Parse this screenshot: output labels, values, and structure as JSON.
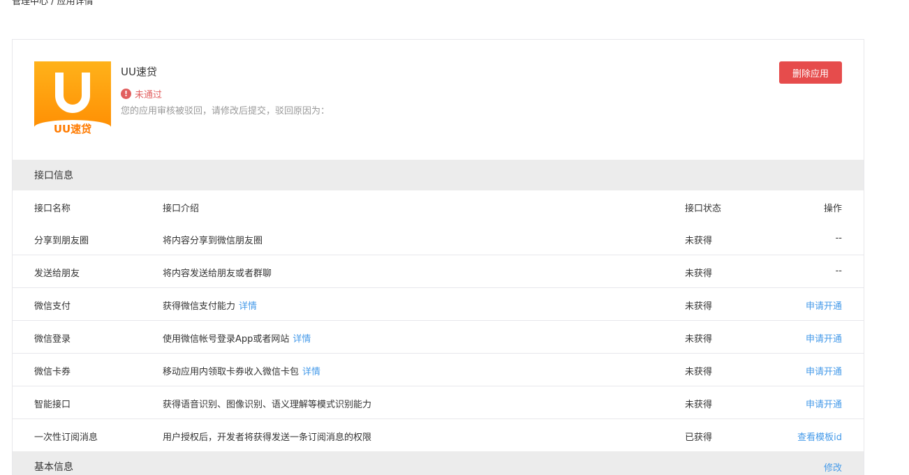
{
  "breadcrumb": "管理中心 / 应用详情",
  "app": {
    "name": "UU速贷",
    "icon_label": "UU速贷",
    "status": "未通过",
    "reason": "您的应用审核被驳回，请修改后提交，驳回原因为：",
    "delete_label": "删除应用"
  },
  "interfaces": {
    "section_title": "接口信息",
    "columns": {
      "name": "接口名称",
      "desc": "接口介绍",
      "state": "接口状态",
      "op": "操作"
    },
    "rows": [
      {
        "name": "分享到朋友圈",
        "desc": "将内容分享到微信朋友圈",
        "detail": "",
        "state": "未获得",
        "op": "--",
        "op_link": false
      },
      {
        "name": "发送给朋友",
        "desc": "将内容发送给朋友或者群聊",
        "detail": "",
        "state": "未获得",
        "op": "--",
        "op_link": false
      },
      {
        "name": "微信支付",
        "desc": "获得微信支付能力",
        "detail": "详情",
        "state": "未获得",
        "op": "申请开通",
        "op_link": true
      },
      {
        "name": "微信登录",
        "desc": "使用微信帐号登录App或者网站",
        "detail": "详情",
        "state": "未获得",
        "op": "申请开通",
        "op_link": true
      },
      {
        "name": "微信卡券",
        "desc": "移动应用内领取卡券收入微信卡包",
        "detail": "详情",
        "state": "未获得",
        "op": "申请开通",
        "op_link": true
      },
      {
        "name": "智能接口",
        "desc": "获得语音识别、图像识别、语义理解等模式识别能力",
        "detail": "",
        "state": "未获得",
        "op": "申请开通",
        "op_link": true
      },
      {
        "name": "一次性订阅消息",
        "desc": "用户授权后，开发者将获得发送一条订阅消息的权限",
        "detail": "",
        "state": "已获得",
        "op": "查看模板id",
        "op_link": true
      }
    ]
  },
  "basic": {
    "section_title": "基本信息",
    "edit_label": "修改"
  },
  "colors": {
    "accent_link": "#459ae9",
    "danger": "#e64c4c",
    "status_error": "#e15f5f",
    "section_bg": "#ececec"
  }
}
